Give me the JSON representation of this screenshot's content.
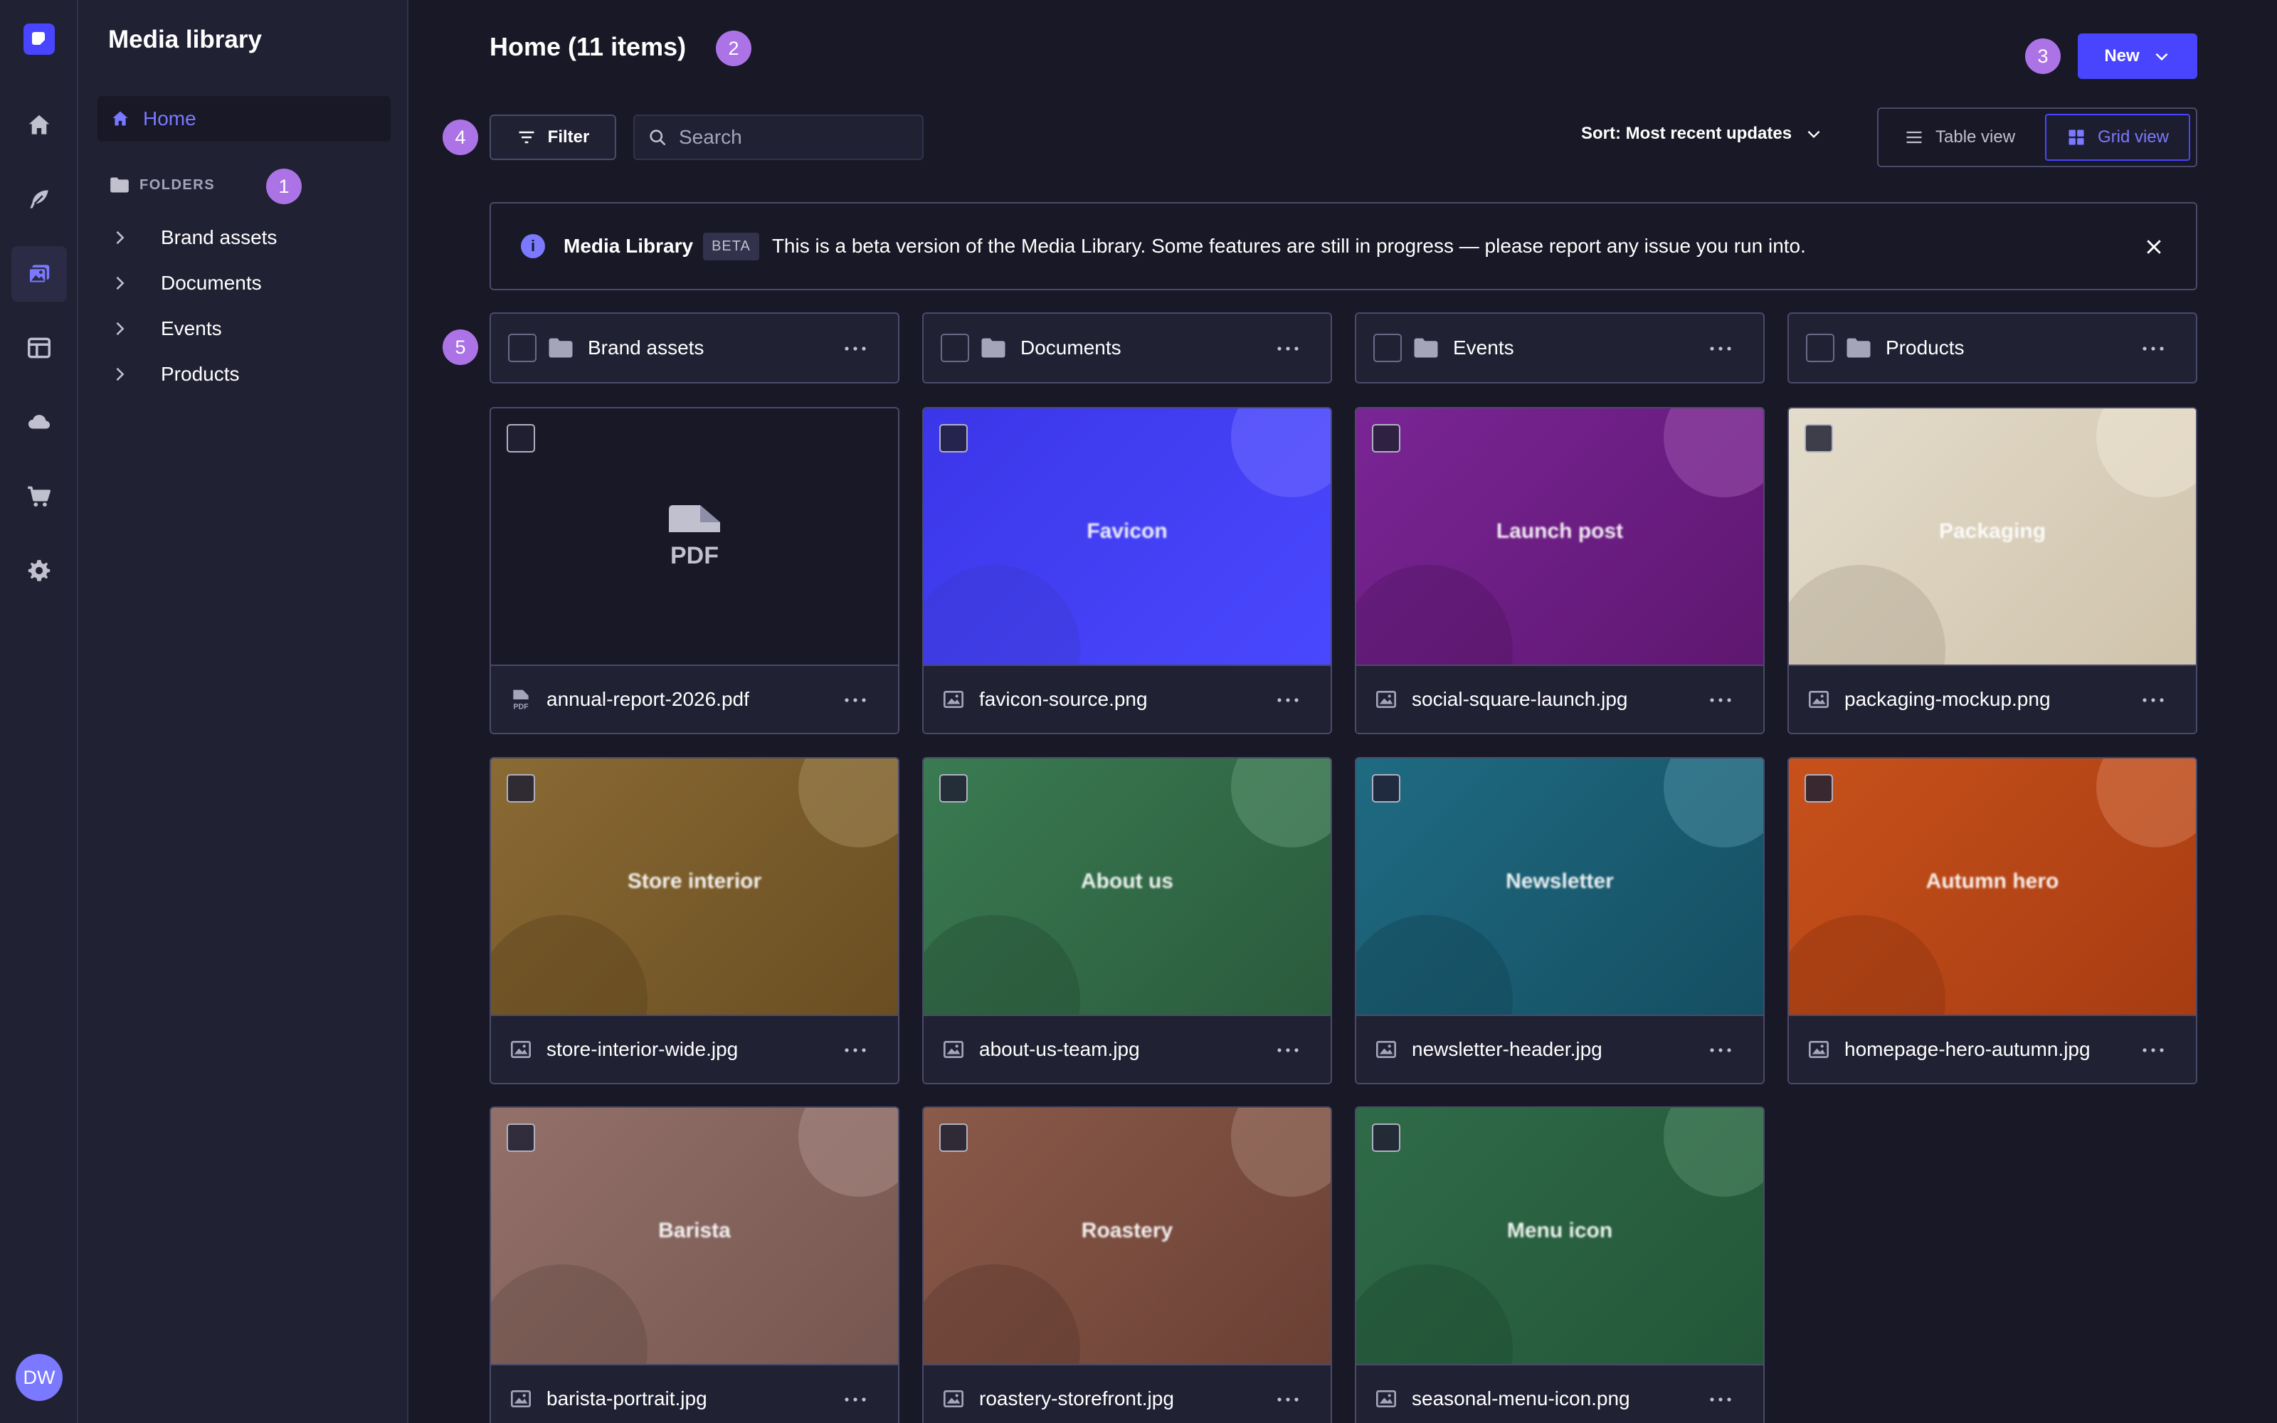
{
  "sidebar": {
    "title": "Media library",
    "home_label": "Home",
    "folders_heading": "FOLDERS",
    "folders": [
      {
        "label": "Brand assets"
      },
      {
        "label": "Documents"
      },
      {
        "label": "Events"
      },
      {
        "label": "Products"
      }
    ]
  },
  "nav_rail": {
    "items": [
      "home-icon",
      "feather-icon",
      "media-library-icon",
      "layout-icon",
      "cloud-icon",
      "cart-icon",
      "gear-icon"
    ],
    "active": "media-library-icon",
    "user_initials": "DW"
  },
  "header": {
    "title": "Home (11 items)",
    "new_button_label": "New"
  },
  "toolbar": {
    "filter_label": "Filter",
    "search_placeholder": "Search",
    "sort_label": "Sort: Most recent updates",
    "table_view_label": "Table view",
    "grid_view_label": "Grid view",
    "active_view": "grid"
  },
  "banner": {
    "title": "Media Library",
    "badge": "BETA",
    "message": "This is a beta version of the Media Library. Some features are still in progress — please report any issue you run into."
  },
  "annotations": [
    "1",
    "2",
    "3",
    "4",
    "5"
  ],
  "folders": [
    {
      "name": "Brand assets"
    },
    {
      "name": "Documents"
    },
    {
      "name": "Events"
    },
    {
      "name": "Products"
    }
  ],
  "assets": [
    {
      "filename": "annual-report-2026.pdf",
      "kind": "pdf",
      "label": "",
      "color_a": "#181826",
      "color_b": "#181826",
      "circle": "#181826"
    },
    {
      "filename": "favicon-source.png",
      "kind": "image",
      "label": "Favicon",
      "color_a": "#3b36e8",
      "color_b": "#4a48ff",
      "circle": "#6f6cff"
    },
    {
      "filename": "social-square-launch.jpg",
      "kind": "image",
      "label": "Launch post",
      "color_a": "#7a2596",
      "color_b": "#5e1770",
      "circle": "#9a52ad"
    },
    {
      "filename": "packaging-mockup.png",
      "kind": "image",
      "label": "Packaging",
      "color_a": "#e4dccb",
      "color_b": "#cfc3ab",
      "circle": "#eee6d6"
    },
    {
      "filename": "store-interior-wide.jpg",
      "kind": "image",
      "label": "Store interior",
      "color_a": "#8a6a34",
      "color_b": "#6a4e22",
      "circle": "#a3885a"
    },
    {
      "filename": "about-us-team.jpg",
      "kind": "image",
      "label": "About us",
      "color_a": "#3a7b52",
      "color_b": "#2a5a3c",
      "circle": "#5e9672"
    },
    {
      "filename": "newsletter-header.jpg",
      "kind": "image",
      "label": "Newsletter",
      "color_a": "#1f6b82",
      "color_b": "#154e62",
      "circle": "#4a8ca0"
    },
    {
      "filename": "homepage-hero-autumn.jpg",
      "kind": "image",
      "label": "Autumn hero",
      "color_a": "#c7511b",
      "color_b": "#a73c12",
      "circle": "#d67a52"
    },
    {
      "filename": "barista-portrait.jpg",
      "kind": "image",
      "label": "Barista",
      "color_a": "#93716a",
      "color_b": "#765650",
      "circle": "#a98d86"
    },
    {
      "filename": "roastery-storefront.jpg",
      "kind": "image",
      "label": "Roastery",
      "color_a": "#8a5a4a",
      "color_b": "#6a4034",
      "circle": "#a37d70"
    },
    {
      "filename": "seasonal-menu-icon.png",
      "kind": "image",
      "label": "Menu icon",
      "color_a": "#2f6b48",
      "color_b": "#235638",
      "circle": "#538a68"
    }
  ]
}
